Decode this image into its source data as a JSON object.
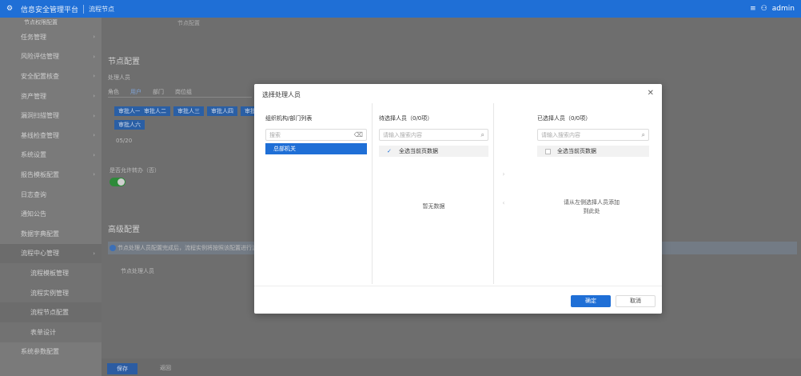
{
  "topbar": {
    "logo_icon": "app-logo-icon",
    "app_title": "信息安全管理平台",
    "tab_label": "流程节点",
    "menu_icon": "menu-icon",
    "user_icon": "user-icon",
    "user_name": "admin"
  },
  "sidebar": {
    "items": [
      {
        "label": "节点权限配置",
        "sub": false,
        "top": true
      },
      {
        "label": "任务管理",
        "arrow": "›"
      },
      {
        "label": "风险评估管理",
        "arrow": "›"
      },
      {
        "label": "安全配置核查",
        "arrow": "›"
      },
      {
        "label": "资产管理",
        "arrow": "›"
      },
      {
        "label": "漏洞扫描管理",
        "arrow": "›"
      },
      {
        "label": "基线检查管理",
        "arrow": "›"
      },
      {
        "label": "系统设置",
        "arrow": "›"
      },
      {
        "label": "报告模板配置",
        "arrow": "›"
      },
      {
        "label": "日志查询"
      },
      {
        "label": "通知公告"
      },
      {
        "label": "数据字典配置"
      },
      {
        "label": "流程中心管理",
        "arrow": "›",
        "active": true
      },
      {
        "label": "流程模板管理",
        "sub": true
      },
      {
        "label": "流程实例管理",
        "sub": true
      },
      {
        "label": "流程节点配置",
        "sub": true,
        "active": true
      },
      {
        "label": "表单设计",
        "sub": true
      },
      {
        "label": "系统参数配置"
      }
    ]
  },
  "main": {
    "crumb": "节点配置",
    "section1_title": "节点配置",
    "field_label": "处理人员",
    "tabs": [
      "角色",
      "用户",
      "部门",
      "岗位组"
    ],
    "chips": [
      "审批人一",
      "审批人二",
      "审批人三",
      "审批人四",
      "审批人五",
      "审批人六"
    ],
    "counter": "05/20",
    "switch_label": "是否允许转办（否）",
    "section2_title": "高级配置",
    "info_text": "节点处理人员配置完成后，流程实例将按照该配置进行流转，请谨慎操作",
    "extra_label": "节点处理人员",
    "save_label": "保存",
    "back_label": "返回"
  },
  "dialog": {
    "title": "选择处理人员",
    "close_icon": "close-icon",
    "col1_head": "组织机构/部门列表",
    "col1_search_placeholder": "搜索",
    "col1_search_icon": "clear-icon",
    "col1_node": "总部机关",
    "col2_head": "待选择人员（0/0项）",
    "col2_search_placeholder": "请输入搜索内容",
    "col2_search_icon": "search-icon",
    "col2_checkall": "全选当前页数据",
    "col2_empty": "暂无数据",
    "col3_head": "已选择人员（0/0项）",
    "col3_search_placeholder": "请输入搜索内容",
    "col3_search_icon": "search-icon",
    "col3_checkall": "全选当前页数据",
    "col3_empty": "请从左侧选择人员添加",
    "col3_empty_sub": "到此处",
    "move_right_icon": "chevron-right-icon",
    "move_left_icon": "chevron-left-icon",
    "ok_label": "确定",
    "cancel_label": "取消"
  }
}
